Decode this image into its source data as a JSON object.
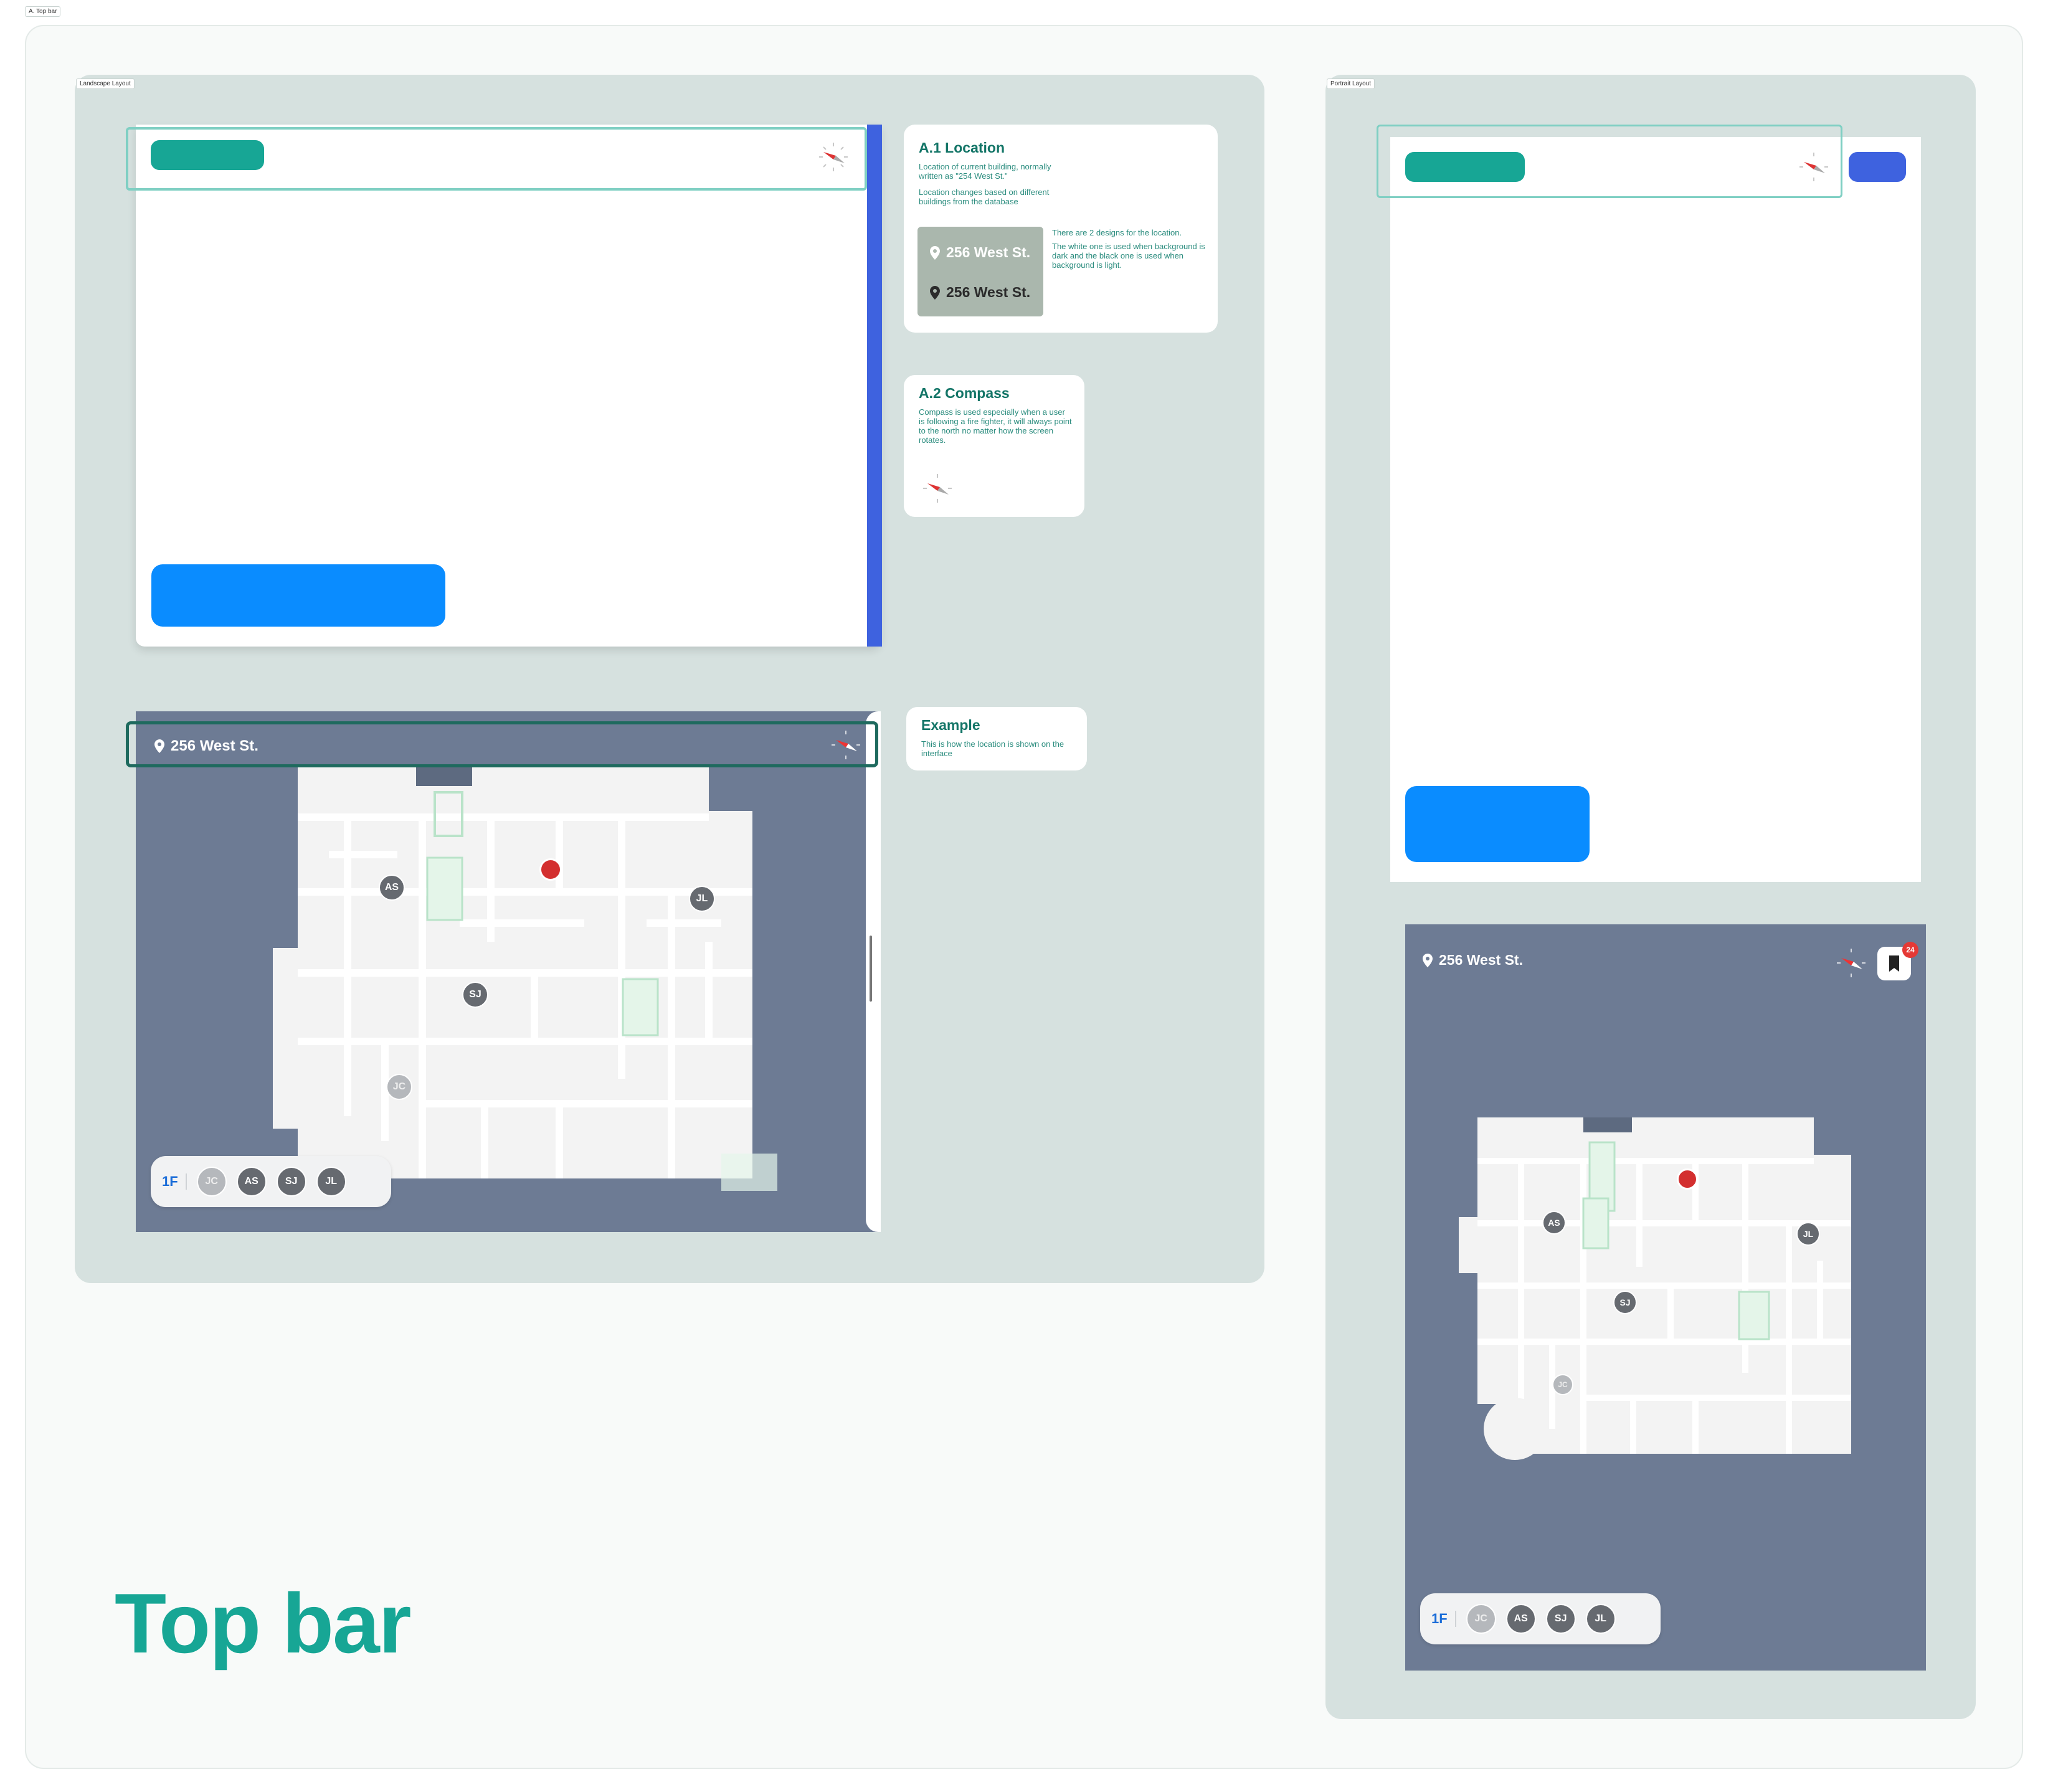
{
  "frame_label": "A. Top bar",
  "landscape_label": "Landscape Layout",
  "portrait_label": "Portrait Layout",
  "page_title": "Top bar",
  "location_card": {
    "heading": "A.1 Location",
    "desc1": "Location of current building, normally written as \"254 West St.\"",
    "desc2": "Location changes based on different buildings from the database",
    "side_note1": "There are 2 designs for the location.",
    "side_note2": "The white one is used when background is dark and the black one is used when background is light.",
    "location_white": "256 West St.",
    "location_black": "256 West St."
  },
  "compass_card": {
    "heading": "A.2 Compass",
    "desc": "Compass is used especially when a user is following a fire fighter, it will always point to the north no matter how the screen rotates."
  },
  "example_card": {
    "heading": "Example",
    "desc": "This is how the location is shown on the interface"
  },
  "example_landscape": {
    "location": "256 West St.",
    "floor": "1F",
    "avatars": [
      "JC",
      "AS",
      "SJ",
      "JL"
    ],
    "map_markers": [
      "AS",
      "JL",
      "SJ",
      "JC"
    ]
  },
  "example_portrait": {
    "location": "256 West St.",
    "badge_count": "24",
    "floor": "1F",
    "avatars": [
      "JC",
      "AS",
      "SJ",
      "JL"
    ],
    "map_markers": [
      "AS",
      "JL",
      "SJ",
      "JC"
    ]
  },
  "colors": {
    "teal": "#17a695",
    "blue": "#0a8cff",
    "indigo": "#3e62df",
    "panel": "#d6e1df",
    "map_bg": "#6d7b94",
    "fire_red": "#d32f2f"
  },
  "icons": [
    "map-pin-icon",
    "compass-icon",
    "firefighter-icon",
    "bookmark-icon"
  ]
}
